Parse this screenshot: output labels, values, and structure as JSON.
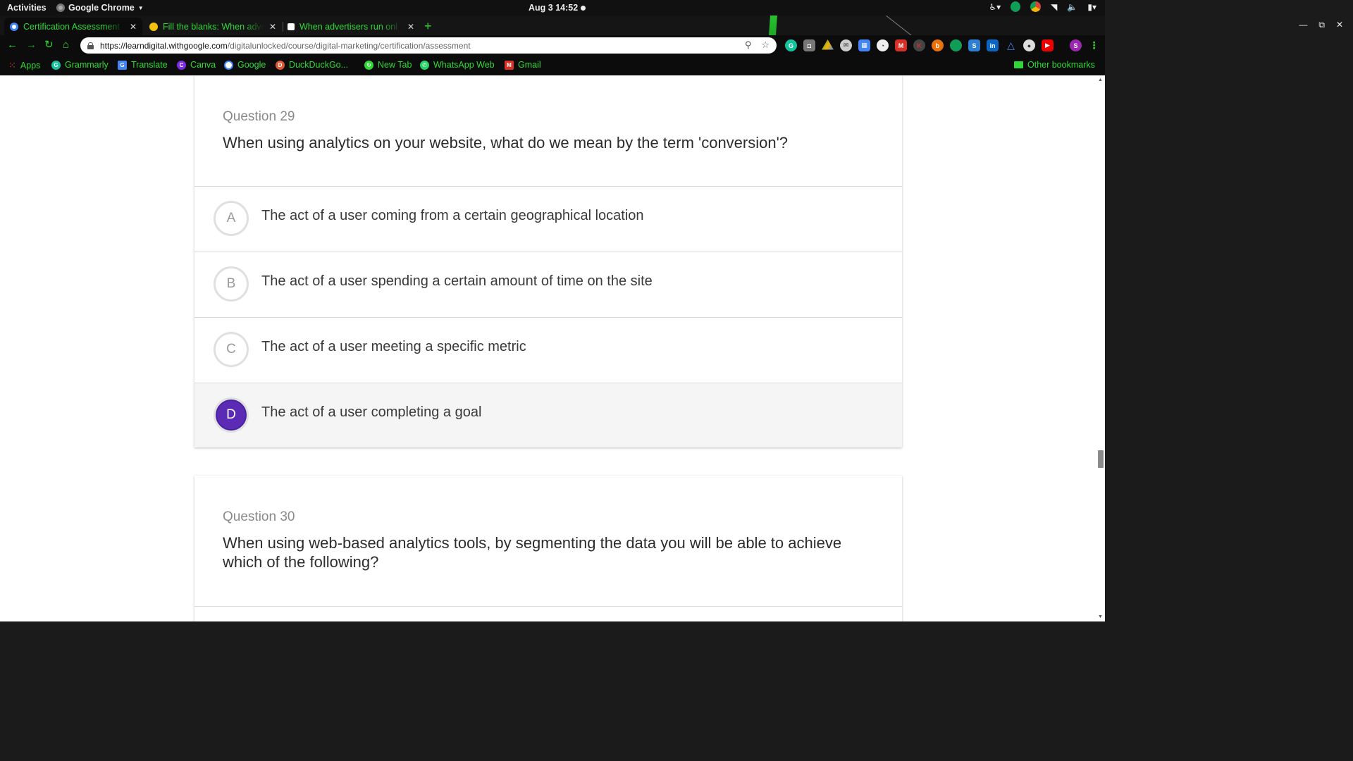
{
  "system_bar": {
    "activities": "Activities",
    "app_name": "Google Chrome",
    "clock": "Aug 3  14:52"
  },
  "browser": {
    "tabs": [
      {
        "title": "Certification Assessment",
        "favicon_color": "#ffffff",
        "active": true
      },
      {
        "title": "Fill the blanks: When adve",
        "favicon_color": "#f4c20d",
        "active": false
      },
      {
        "title": "When advertisers run onl",
        "favicon_color": "#111111",
        "active": false
      }
    ],
    "url_host": "https://learndigital.withgoogle.com",
    "url_path": "/digitalunlocked/course/digital-marketing/certification/assessment",
    "bookmarks": [
      {
        "label": "Apps",
        "icon": "apps-grid-icon",
        "color": "#e94235"
      },
      {
        "label": "Grammarly",
        "icon": "grammarly-icon",
        "color": "#15c39a"
      },
      {
        "label": "Translate",
        "icon": "translate-icon",
        "color": "#4285f4"
      },
      {
        "label": "Canva",
        "icon": "canva-icon",
        "color": "#7d2ae8"
      },
      {
        "label": "Google",
        "icon": "google-icon",
        "color": "#4285f4"
      },
      {
        "label": "DuckDuckGo...",
        "icon": "duckduckgo-icon",
        "color": "#de5833"
      },
      {
        "label": "New Tab",
        "icon": "newtab-icon",
        "color": "#2fd836"
      },
      {
        "label": "WhatsApp Web",
        "icon": "whatsapp-icon",
        "color": "#25d366"
      },
      {
        "label": "Gmail",
        "icon": "gmail-icon",
        "color": "#d93025"
      }
    ],
    "other_bookmarks": "Other bookmarks",
    "accent_color": "#2fd836"
  },
  "assessment": {
    "question_29": {
      "number_label": "Question 29",
      "text": "When using analytics on your website, what do we mean by the term 'conversion'?",
      "options": [
        {
          "letter": "A",
          "text": "The act of a user coming from a certain geographical location",
          "selected": false
        },
        {
          "letter": "B",
          "text": "The act of a user spending a certain amount of time on the site",
          "selected": false
        },
        {
          "letter": "C",
          "text": "The act of a user meeting a specific metric",
          "selected": false
        },
        {
          "letter": "D",
          "text": "The act of a user completing a goal",
          "selected": true
        }
      ]
    },
    "question_30": {
      "number_label": "Question 30",
      "text": "When using web-based analytics tools, by segmenting the data you will be able to achieve which of the following?"
    },
    "selected_color": "#5b2bb5"
  }
}
